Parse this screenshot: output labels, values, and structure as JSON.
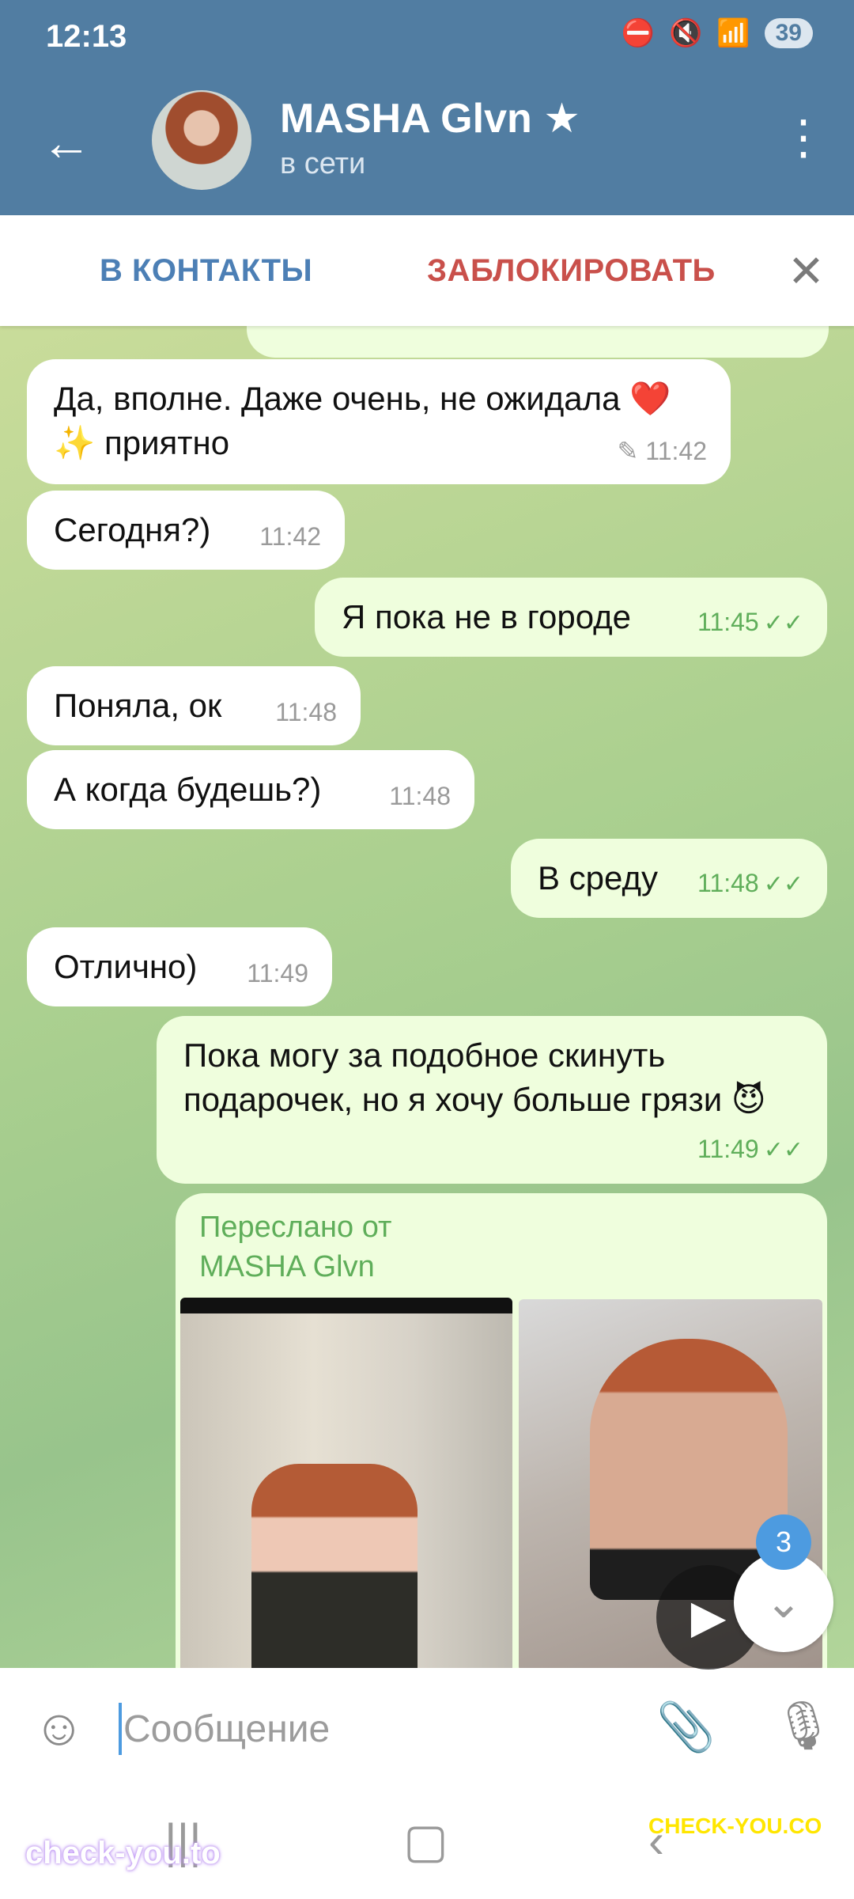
{
  "status_bar": {
    "time": "12:13",
    "battery": "39"
  },
  "header": {
    "name": "MASHA Glvn",
    "star": "★",
    "status": "в сети"
  },
  "actions": {
    "add_contact": "В КОНТАКТЫ",
    "block": "ЗАБЛОКИРОВАТЬ"
  },
  "messages": [
    {
      "dir": "in",
      "text": "Да, вполне. Даже очень, не ожидала ❤️✨ приятно",
      "time": "11:42",
      "edited": true
    },
    {
      "dir": "in",
      "text": "Сегодня?)",
      "time": "11:42"
    },
    {
      "dir": "out",
      "text": "Я пока не в городе",
      "time": "11:45",
      "read": true
    },
    {
      "dir": "in",
      "text": "Поняла, ок",
      "time": "11:48"
    },
    {
      "dir": "in",
      "text": "А когда будешь?)",
      "time": "11:48"
    },
    {
      "dir": "out",
      "text": "В среду",
      "time": "11:48",
      "read": true
    },
    {
      "dir": "in",
      "text": "Отлично)",
      "time": "11:49"
    },
    {
      "dir": "out",
      "text": "Пока могу за подобное  скинуть подарочек, но я хочу больше грязи 😈",
      "time": "11:49",
      "read": true
    }
  ],
  "forwarded": {
    "label_line1": "Переслано от",
    "label_line2": "MASHA Glvn"
  },
  "scroll": {
    "unread_count": "3"
  },
  "composer": {
    "placeholder": "Сообщение"
  },
  "watermarks": {
    "left": "check-you.to",
    "right": "CHECK-YOU.CO"
  },
  "colors": {
    "header": "#517da2",
    "outgoing": "#effedd",
    "accent": "#5fae5a",
    "block": "#c9504b",
    "link": "#4c7fb5"
  }
}
